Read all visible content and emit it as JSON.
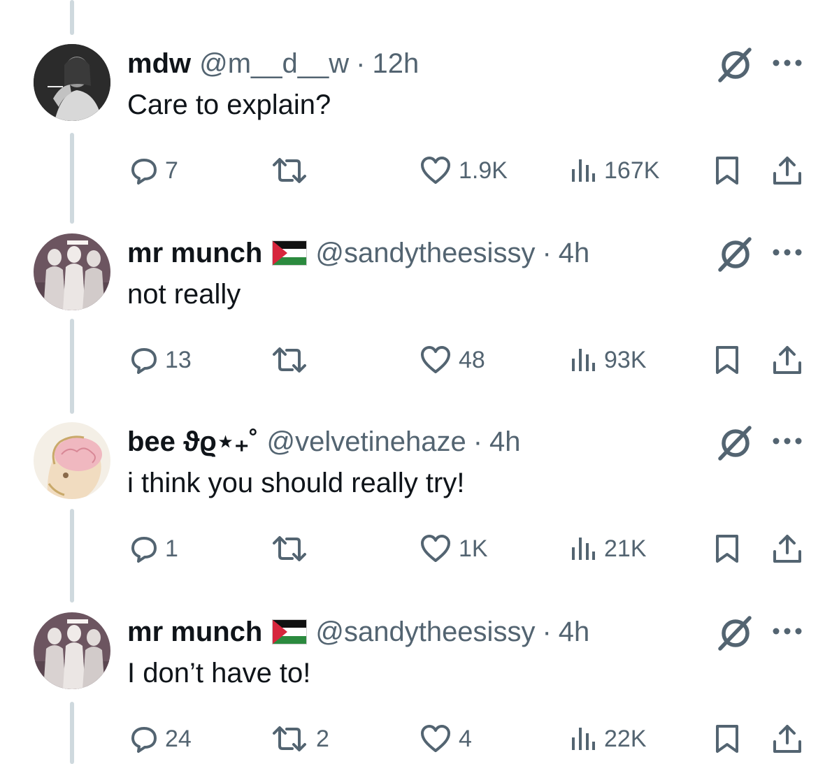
{
  "colors": {
    "text": "#0f1419",
    "secondary": "#536471",
    "thread_line": "#cfd9de",
    "background": "#ffffff"
  },
  "tweets": [
    {
      "name": "mdw",
      "flag": "",
      "handle": "@m__d__w",
      "separator": "·",
      "time": "12h",
      "text": "Care to explain?",
      "replies": "7",
      "retweets": "",
      "likes": "1.9K",
      "views": "167K",
      "avatar": "man-smoking-bw-avatar"
    },
    {
      "name": "mr munch",
      "flag": "palestine-flag",
      "handle": "@sandytheesissy",
      "separator": "·",
      "time": "4h",
      "text": "not really",
      "replies": "13",
      "retweets": "",
      "likes": "48",
      "views": "93K",
      "avatar": "group-photo-avatar"
    },
    {
      "name": "bee ϑϱ⋆₊˚",
      "flag": "",
      "handle": "@velvetinehaze",
      "separator": "·",
      "time": "4h",
      "text": "i think you should really try!",
      "replies": "1",
      "retweets": "",
      "likes": "1K",
      "views": "21K",
      "avatar": "brain-drawing-avatar"
    },
    {
      "name": "mr munch",
      "flag": "palestine-flag",
      "handle": "@sandytheesissy",
      "separator": "·",
      "time": "4h",
      "text": "I don’t have to!",
      "replies": "24",
      "retweets": "2",
      "likes": "4",
      "views": "22K",
      "avatar": "group-photo-avatar"
    }
  ],
  "icons": {
    "reply": "speech-bubble-icon",
    "retweet": "retweet-arrows-icon",
    "like": "heart-icon",
    "views": "bar-chart-icon",
    "bookmark": "bookmark-icon",
    "share": "share-upload-icon",
    "grok": "grok-slash-icon",
    "more": "more-dots-icon"
  }
}
